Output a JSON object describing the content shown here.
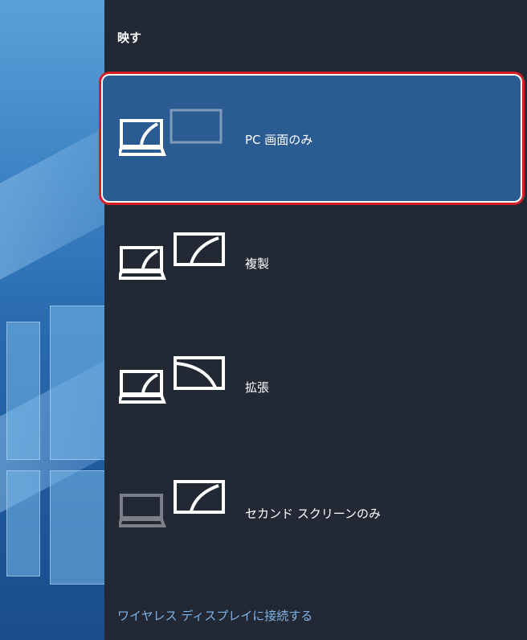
{
  "panel": {
    "title": "映す",
    "options": [
      {
        "label": "PC 画面のみ",
        "icon": "pc-screen-only-icon",
        "selected": true
      },
      {
        "label": "複製",
        "icon": "duplicate-icon",
        "selected": false
      },
      {
        "label": "拡張",
        "icon": "extend-icon",
        "selected": false
      },
      {
        "label": "セカンド スクリーンのみ",
        "icon": "second-screen-only-icon",
        "selected": false
      }
    ],
    "wireless_link": "ワイヤレス ディスプレイに接続する"
  },
  "colors": {
    "panel_bg": "#222834",
    "selected_bg": "#2b5b93",
    "highlight_border": "#d21f28",
    "link": "#7fb3e8"
  }
}
